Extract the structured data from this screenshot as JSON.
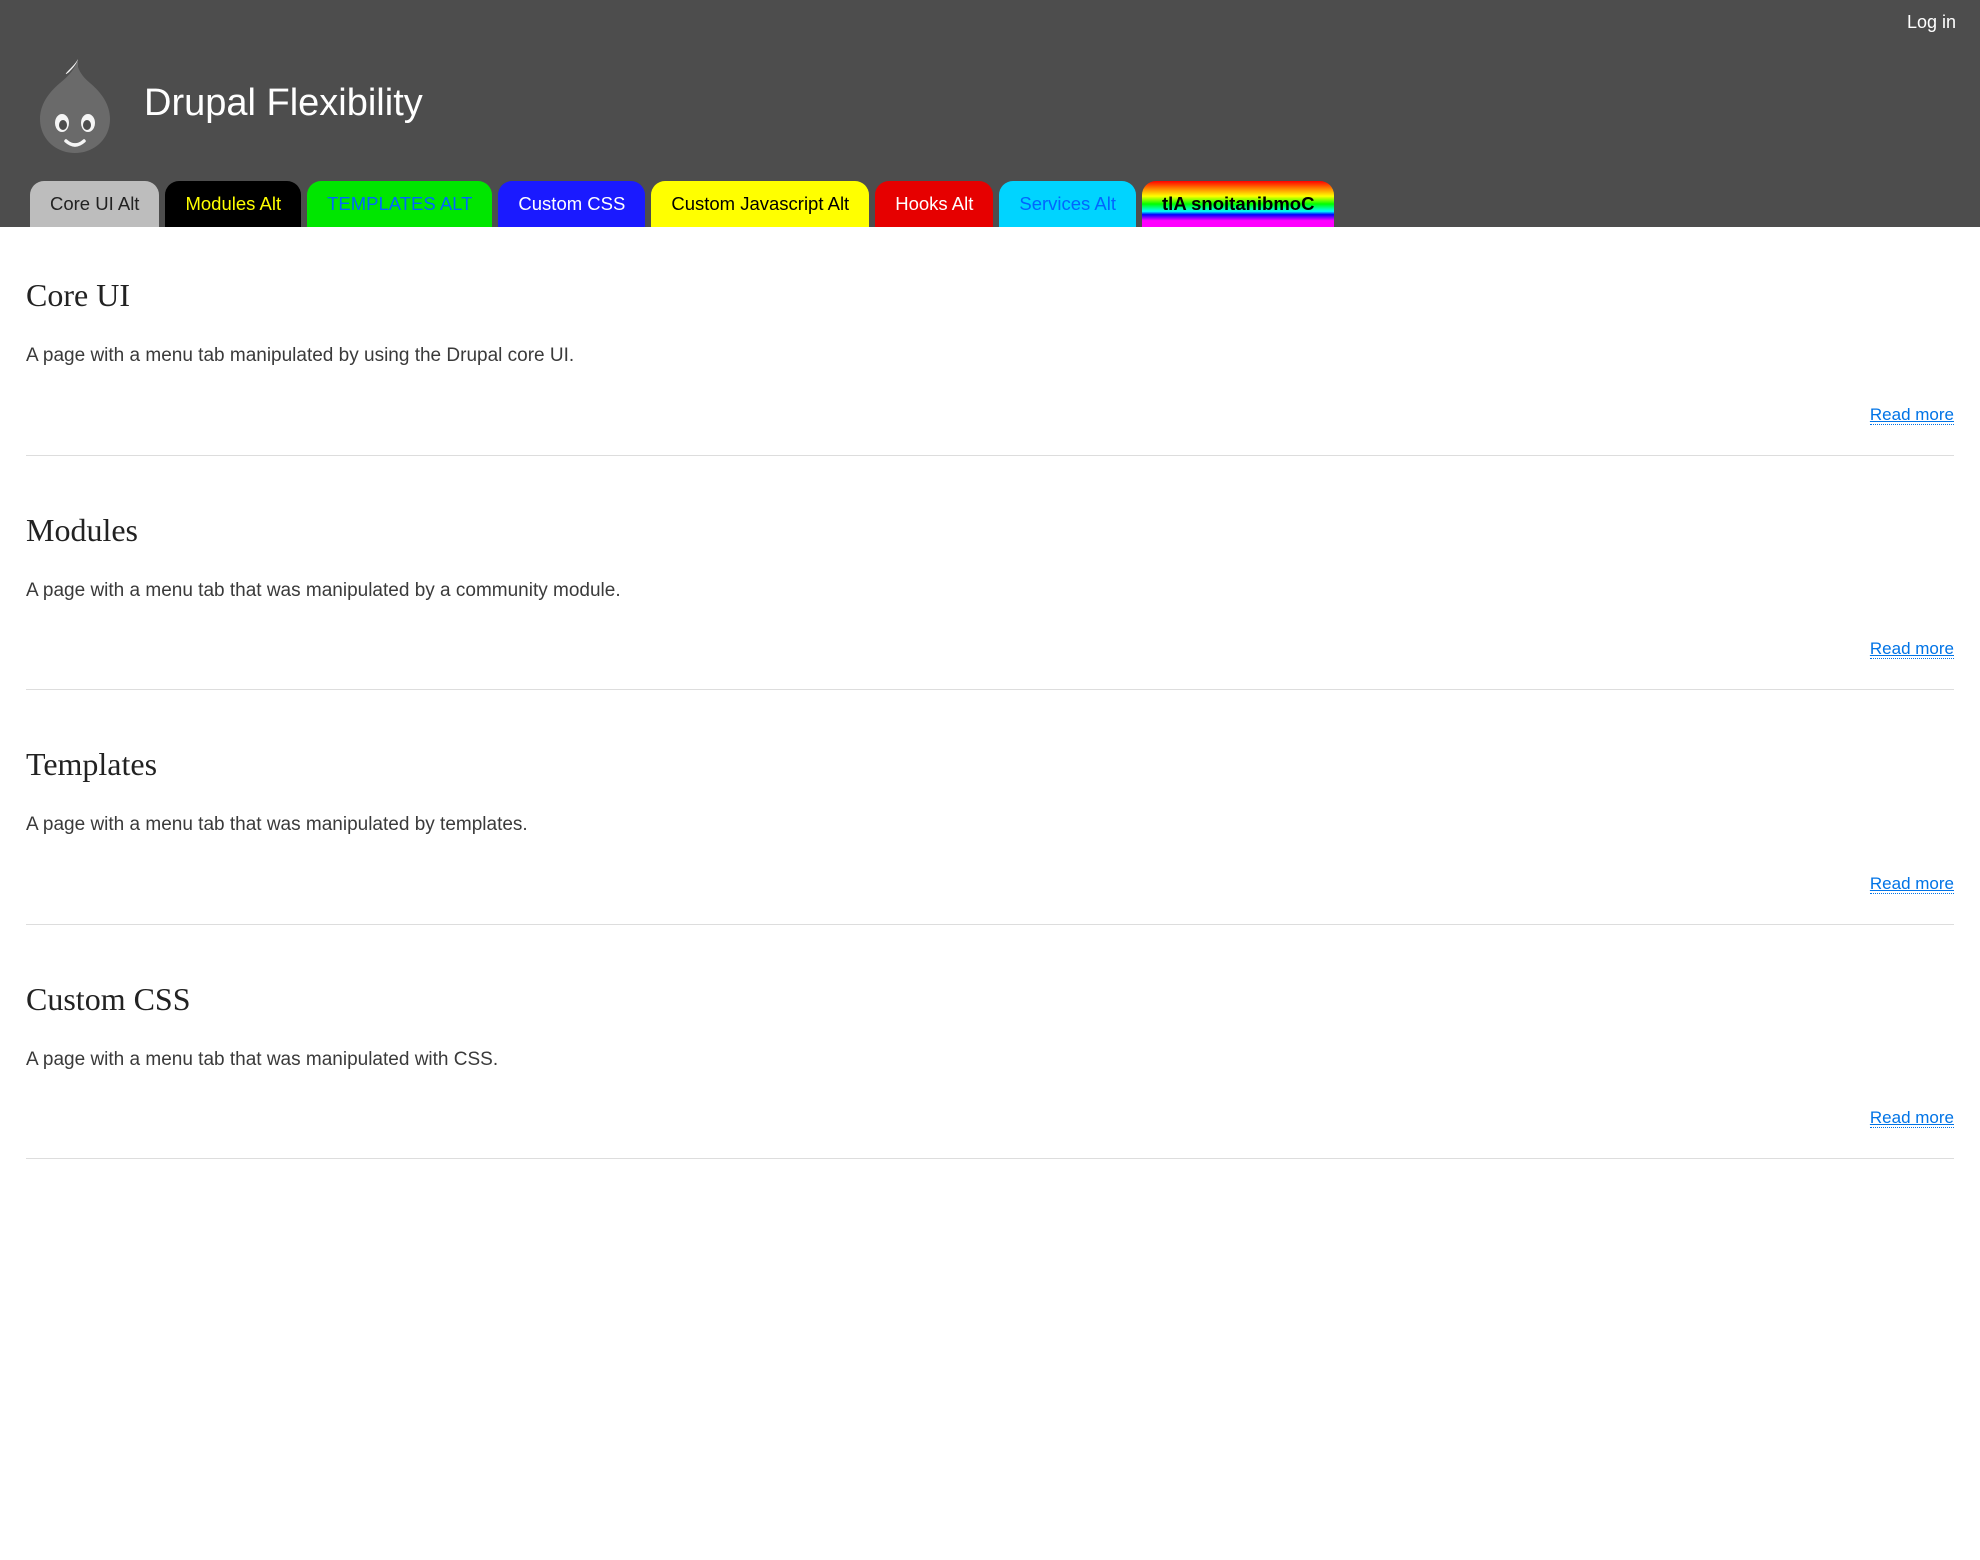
{
  "user_menu": {
    "login": "Log in"
  },
  "site_name": "Drupal Flexibility",
  "nav": [
    {
      "label": "Core UI Alt",
      "cls": "tab-core"
    },
    {
      "label": "Modules Alt",
      "cls": "tab-modules"
    },
    {
      "label": "TEMPLATES ALT",
      "cls": "tab-templates"
    },
    {
      "label": "Custom CSS",
      "cls": "tab-css"
    },
    {
      "label": "Custom Javascript Alt",
      "cls": "tab-js"
    },
    {
      "label": "Hooks Alt",
      "cls": "tab-hooks"
    },
    {
      "label": "Services Alt",
      "cls": "tab-services"
    },
    {
      "label": "tlA snoitanibmoC",
      "cls": "tab-combos"
    }
  ],
  "read_more_label": "Read more",
  "articles": [
    {
      "title": "Core UI",
      "body": "A page with a menu tab manipulated by using the Drupal core UI."
    },
    {
      "title": "Modules",
      "body": "A page with a menu tab that was manipulated by a community module."
    },
    {
      "title": "Templates",
      "body": "A page with a menu tab that was manipulated by templates."
    },
    {
      "title": "Custom CSS",
      "body": "A page with a menu tab that was manipulated with CSS."
    }
  ]
}
